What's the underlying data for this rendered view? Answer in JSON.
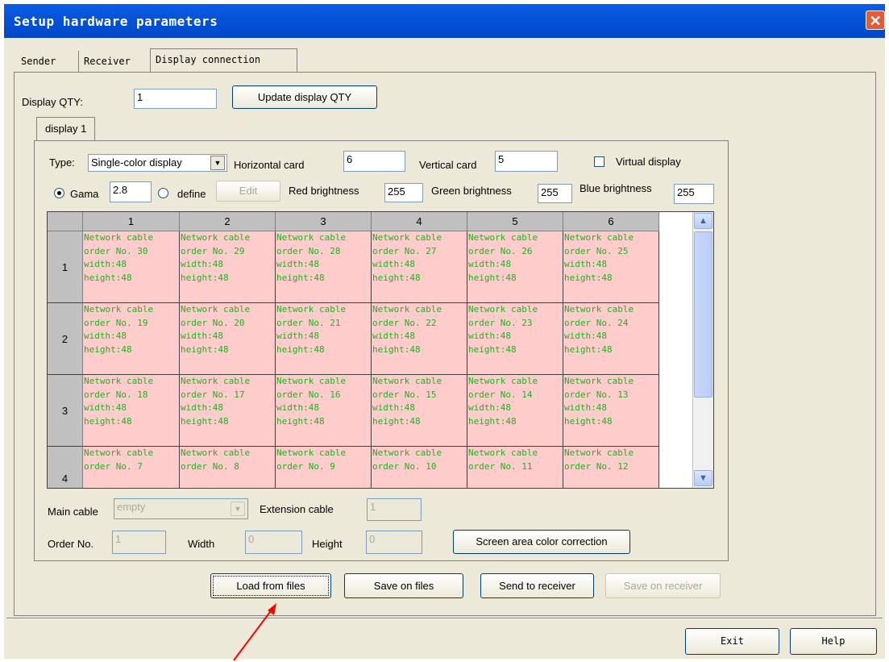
{
  "window": {
    "title": "Setup hardware parameters",
    "close_icon": "close-icon"
  },
  "tabs": [
    "Sender",
    "Receiver",
    "Display connection"
  ],
  "display_qty": {
    "label": "Display QTY:",
    "value": "1",
    "update_button": "Update display QTY"
  },
  "display_tab": "display 1",
  "type": {
    "label": "Type:",
    "value": "Single-color display"
  },
  "horizontal_card": {
    "label": "Horizontal card",
    "value": "6"
  },
  "vertical_card": {
    "label": "Vertical card",
    "value": "5"
  },
  "virtual_display": {
    "label": "Virtual display",
    "checked": false
  },
  "gamma": {
    "label": "Gama",
    "value": "2.8",
    "selected": true
  },
  "define": {
    "label": "define",
    "edit_button": "Edit"
  },
  "red_brightness": {
    "label": "Red brightness",
    "value": "255"
  },
  "green_brightness": {
    "label": "Green brightness",
    "value": "255"
  },
  "blue_brightness": {
    "label": "Blue brightness",
    "value": "255"
  },
  "grid": {
    "columns": [
      "1",
      "2",
      "3",
      "4",
      "5",
      "6"
    ],
    "rows": [
      {
        "label": "1",
        "cells": [
          "Network cable\norder No. 30\nwidth:48\nheight:48",
          "Network cable\norder No. 29\nwidth:48\nheight:48",
          "Network cable\norder No. 28\nwidth:48\nheight:48",
          "Network cable\norder No. 27\nwidth:48\nheight:48",
          "Network cable\norder No. 26\nwidth:48\nheight:48",
          "Network cable\norder No. 25\nwidth:48\nheight:48"
        ]
      },
      {
        "label": "2",
        "cells": [
          "Network cable\norder No. 19\nwidth:48\nheight:48",
          "Network cable\norder No. 20\nwidth:48\nheight:48",
          "Network cable\norder No. 21\nwidth:48\nheight:48",
          "Network cable\norder No. 22\nwidth:48\nheight:48",
          "Network cable\norder No. 23\nwidth:48\nheight:48",
          "Network cable\norder No. 24\nwidth:48\nheight:48"
        ]
      },
      {
        "label": "3",
        "cells": [
          "Network cable\norder No. 18\nwidth:48\nheight:48",
          "Network cable\norder No. 17\nwidth:48\nheight:48",
          "Network cable\norder No. 16\nwidth:48\nheight:48",
          "Network cable\norder No. 15\nwidth:48\nheight:48",
          "Network cable\norder No. 14\nwidth:48\nheight:48",
          "Network cable\norder No. 13\nwidth:48\nheight:48"
        ]
      },
      {
        "label": "4",
        "cells": [
          "Network cable\norder No. 7",
          "Network cable\norder No. 8",
          "Network cable\norder No. 9",
          "Network cable\norder No. 10",
          "Network cable\norder No. 11",
          "Network cable\norder No. 12"
        ]
      }
    ]
  },
  "main_cable": {
    "label": "Main cable",
    "value": "empty"
  },
  "extension_cable": {
    "label": "Extension cable",
    "value": "1"
  },
  "order_no": {
    "label": "Order No.",
    "value": "1"
  },
  "width": {
    "label": "Width",
    "value": "0"
  },
  "height": {
    "label": "Height",
    "value": "0"
  },
  "buttons": {
    "color_correction": "Screen area color correction",
    "load": "Load from files",
    "save": "Save on files",
    "send": "Send to receiver",
    "save_receiver": "Save on receiver",
    "exit": "Exit",
    "help": "Help"
  },
  "colors": {
    "titlebar": "#0653d8",
    "cell_bg": "#ffcccc",
    "cell_text": "#22b022",
    "annotation_arrow": "#ff0000"
  }
}
